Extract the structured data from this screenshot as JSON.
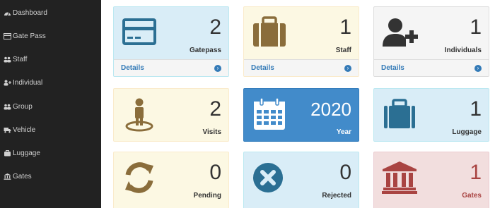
{
  "sidebar": {
    "items": [
      {
        "label": "Dashboard",
        "icon": "dashboard-icon"
      },
      {
        "label": "Gate Pass",
        "icon": "credit-card-icon"
      },
      {
        "label": "Staff",
        "icon": "users-icon"
      },
      {
        "label": "Individual",
        "icon": "user-plus-icon"
      },
      {
        "label": "Group",
        "icon": "users-icon"
      },
      {
        "label": "Vehicle",
        "icon": "truck-icon"
      },
      {
        "label": "Luggage",
        "icon": "briefcase-icon"
      },
      {
        "label": "Gates",
        "icon": "bank-icon"
      }
    ]
  },
  "cards": [
    {
      "count": "2",
      "label": "Gatepass",
      "footer": "Details",
      "icon": "credit-card-icon",
      "color": "#d9edf7"
    },
    {
      "count": "1",
      "label": "Staff",
      "footer": "Details",
      "icon": "briefcase-icon",
      "color": "#fcf8e3"
    },
    {
      "count": "1",
      "label": "Individuals",
      "footer": "Details",
      "icon": "user-plus-icon",
      "color": "#f5f5f5"
    },
    {
      "count": "2",
      "label": "Visits",
      "icon": "street-view-icon",
      "color": "#fcf8e3"
    },
    {
      "count": "2020",
      "label": "Year",
      "icon": "calendar-icon",
      "color": "#428bca"
    },
    {
      "count": "1",
      "label": "Luggage",
      "icon": "suitcase-icon",
      "color": "#d9edf7"
    },
    {
      "count": "0",
      "label": "Pending",
      "icon": "refresh-icon",
      "color": "#fcf8e3"
    },
    {
      "count": "0",
      "label": "Rejected",
      "icon": "times-circle-icon",
      "color": "#d9edf7"
    },
    {
      "count": "1",
      "label": "Gates",
      "icon": "bank-icon",
      "color": "#f2dede"
    }
  ]
}
